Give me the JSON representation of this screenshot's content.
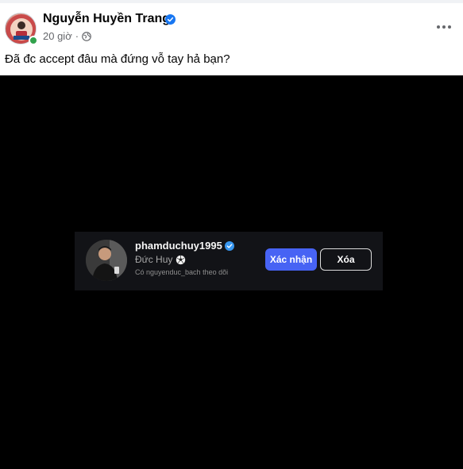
{
  "post": {
    "author_name": "Nguyễn Huyền Trang",
    "timestamp": "20 giờ",
    "separator": "·",
    "caption": "Đã đc accept đâu mà đứng vỗ tay hả bạn?",
    "icons": {
      "verified": "verified-badge-icon",
      "audience": "globe-icon",
      "more": "more-options-icon"
    },
    "colors": {
      "verified": "#1877f2",
      "online": "#31a24c",
      "meta_text": "#65676b"
    }
  },
  "follow_request": {
    "username": "phamduchuy1995",
    "full_name": "Đức Huy",
    "followed_by": "Có nguyenduc_bach theo dõi",
    "confirm_label": "Xác nhận",
    "delete_label": "Xóa",
    "icons": {
      "verified": "verified-badge-icon",
      "emoji": "soccer-ball-icon"
    },
    "colors": {
      "confirm": "#4763f4",
      "background": "#121317"
    }
  }
}
